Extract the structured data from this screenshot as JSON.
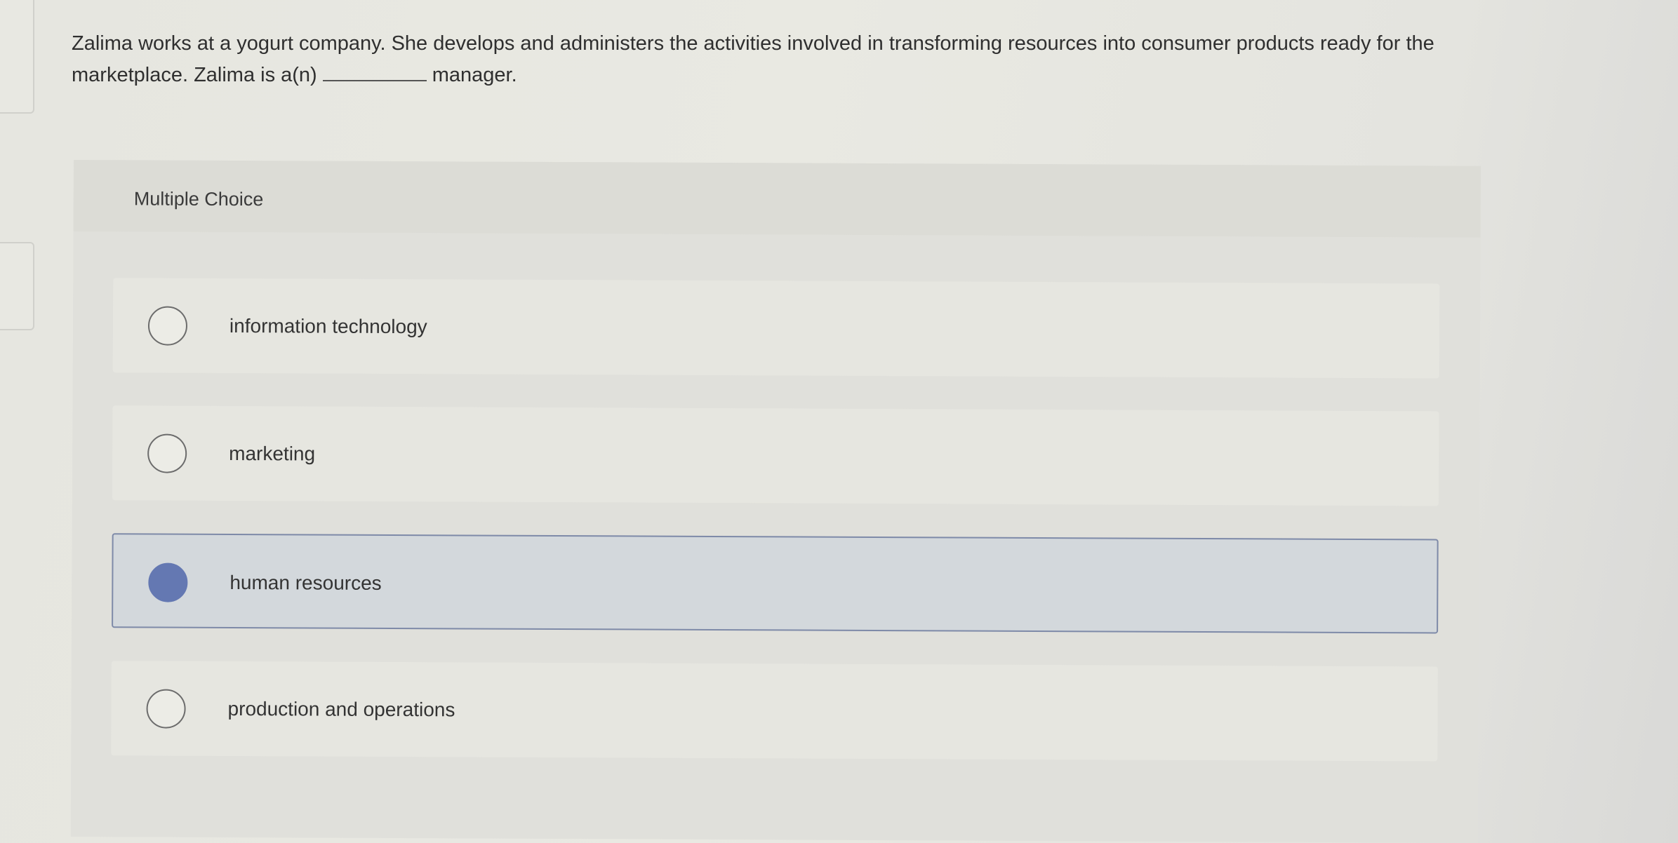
{
  "question": {
    "text_before_blank": "Zalima works at a yogurt company. She develops and administers the activities involved in transforming resources into consumer products ready for the marketplace. Zalima is a(n)",
    "text_after_blank": "manager."
  },
  "multiple_choice": {
    "title": "Multiple Choice",
    "options": [
      {
        "label": "information technology",
        "selected": false
      },
      {
        "label": "marketing",
        "selected": false
      },
      {
        "label": "human resources",
        "selected": true
      },
      {
        "label": "production and operations",
        "selected": false
      }
    ]
  },
  "colors": {
    "selected_fill": "#6478b2",
    "selected_border": "#7e8aa8",
    "selected_background": "#d3d8dc"
  }
}
